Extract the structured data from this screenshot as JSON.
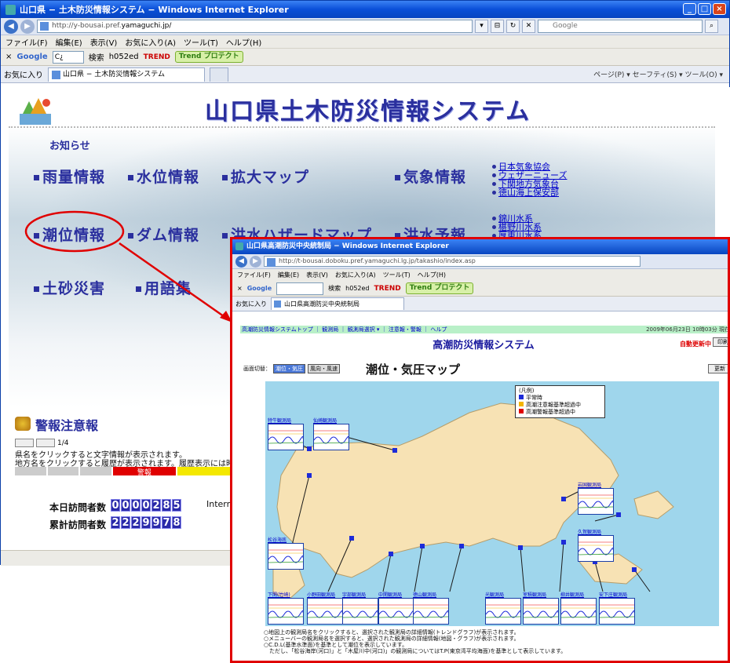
{
  "window": {
    "title": "山口県 − 土木防災情報システム − Windows Internet Explorer",
    "url_prefix": "http://y-bousai.pref.",
    "url_domain": "yamaguchi.jp/",
    "search_placeholder": "Google",
    "controls": [
      "_",
      "□",
      "×"
    ]
  },
  "menu": [
    "ファイル(F)",
    "編集(E)",
    "表示(V)",
    "お気に入り(A)",
    "ツール(T)",
    "ヘルプ(H)"
  ],
  "toolbar": {
    "google_label": "Google",
    "google_input": "C¿",
    "search_label": "検索",
    "h052": "h052ed",
    "trend_label": "TREND",
    "trend_protect": "Trend プロテクト"
  },
  "tabs": {
    "favorites": "お気に入り",
    "active_tab": "山口県 − 土木防災情報システム",
    "tools": "ページ(P) ▾  セーフティ(S) ▾  ツール(O) ▾"
  },
  "page": {
    "site_title": "山口県土木防災情報システム",
    "notice": "お知らせ",
    "links": [
      {
        "label": "雨量情報"
      },
      {
        "label": "水位情報"
      },
      {
        "label": "拡大マップ"
      },
      {
        "label": "気象情報"
      },
      {
        "label": "潮位情報"
      },
      {
        "label": "ダム情報"
      },
      {
        "label": "洪水ハザードマップ"
      },
      {
        "label": "洪水予報"
      },
      {
        "label": "土砂災害"
      },
      {
        "label": "用語集"
      }
    ],
    "weather_links": [
      "日本気象協会",
      "ウェザーニューズ",
      "下関地方気象台",
      "徳山海上保安部"
    ],
    "flood_links": [
      "錦川水系",
      "椹野川水系",
      "厚東川水系"
    ],
    "warning_heading": "警報注意報",
    "page_counter": "1/4",
    "info_line1": "県名をクリックすると文字情報が表示されます。",
    "info_line2": "地方名をクリックすると履歴が表示されます。履歴表示には時間がかかります",
    "warn_label": "警報",
    "today_label": "本日訪問者数 ：",
    "today_count": "0000285",
    "total_label": "累計訪問者数 ：",
    "total_count": "2229978",
    "internet_text": "Interne"
  },
  "inset": {
    "title": "山口県高潮防災中央統制局 − Windows Internet Explorer",
    "url": "http://t-bousai.doboku.pref.yamaguchi.lg.jp/takashio/index.asp",
    "tab": "山口県高潮防災中央統制局",
    "nav_links": "高潮防災情報システムトップ ｜ 観測局 ｜ 観測局選択 ▾ ｜ 注意報・警報 ｜ ヘルプ",
    "datetime": "2009年06月23日 10時03分 現在",
    "system_title": "高潮防災情報システム",
    "auto_update": "自動更新中",
    "print_label": "印刷",
    "display_switch": "画面切替：",
    "switch_on": "潮位・気圧",
    "switch_off": "風向・風速",
    "map_title": "潮位・気圧マップ",
    "refresh_label": "更新",
    "legend": {
      "title": "(凡例)",
      "items": [
        {
          "label": "平常時",
          "color": "#1d2bd8"
        },
        {
          "label": "高潮注意報基準超過中",
          "color": "#f4b400"
        },
        {
          "label": "高潮警報基準超過中",
          "color": "#e00000"
        }
      ]
    },
    "stations": [
      "特牛観測局",
      "仙崎観測局",
      "松谷海底",
      "下関(竹崎)",
      "小野田観測局",
      "宇部観測局",
      "中関観測局",
      "徳山観測局",
      "光観測局",
      "室積観測局",
      "柳井観測局",
      "安下庄観測局",
      "岩国観測局",
      "久賀観測局"
    ],
    "notes": [
      "○地図上の観測局名をクリックすると、選択された観測局の詳細情報(トレンドグラフ)が表示されます。",
      "○メニューバーの観測局名を選択すると、選択された観測局の詳細情報(地図・グラフ)が表示されます。",
      "○C.D.L(基準水準面)を基準として潮位を表示しています。",
      "　ただし、「松谷海岸(河口)」と「木屋川中(河口)」の観測局についてはT.P(東京湾平均海面)を基準として表示しています。"
    ]
  }
}
